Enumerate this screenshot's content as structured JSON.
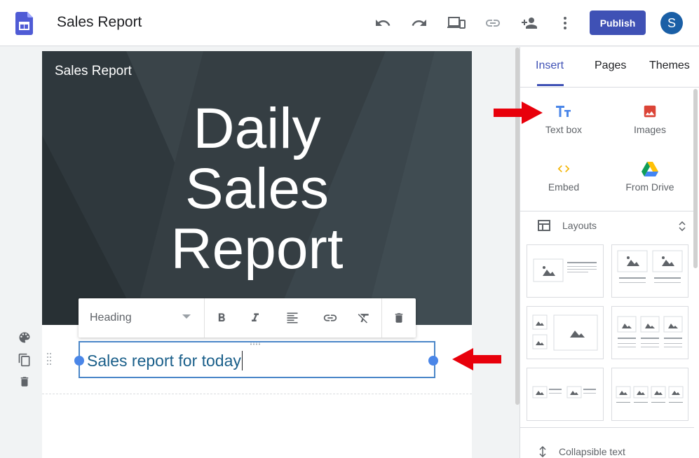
{
  "app": {
    "title": "Sales Report",
    "publish_label": "Publish",
    "avatar_initial": "S",
    "accent_color": "#3f51b5"
  },
  "toolbar_icons": [
    "undo-icon",
    "redo-icon",
    "preview-icon",
    "link-icon",
    "share-icon",
    "more-icon"
  ],
  "left_tools": [
    "palette-icon",
    "duplicate-icon",
    "delete-icon"
  ],
  "canvas": {
    "site_title": "Sales Report",
    "heading_lines": [
      "Daily",
      "Sales",
      "Report"
    ],
    "text_box_content": "Sales report for today"
  },
  "format_toolbar": {
    "style_value": "Heading",
    "buttons": [
      "bold-icon",
      "italic-icon",
      "align-icon",
      "link-icon",
      "clear-format-icon",
      "delete-icon"
    ]
  },
  "panel": {
    "tabs": [
      {
        "label": "Insert",
        "active": true
      },
      {
        "label": "Pages",
        "active": false
      },
      {
        "label": "Themes",
        "active": false
      }
    ],
    "insert_items": [
      {
        "label": "Text box",
        "icon": "text-box-icon"
      },
      {
        "label": "Images",
        "icon": "image-icon"
      },
      {
        "label": "Embed",
        "icon": "embed-icon"
      },
      {
        "label": "From Drive",
        "icon": "drive-icon"
      }
    ],
    "layouts_label": "Layouts",
    "collapsible_label": "Collapsible text"
  }
}
